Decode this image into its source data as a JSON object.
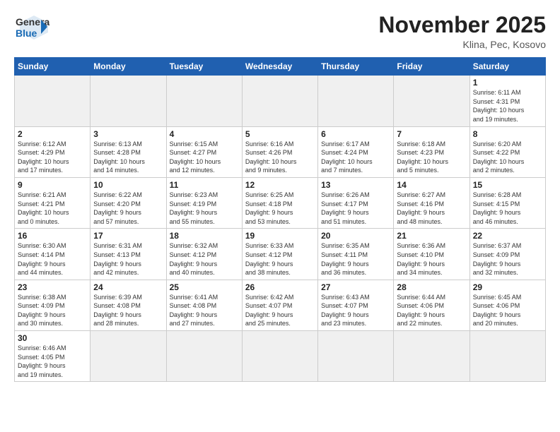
{
  "header": {
    "logo_general": "General",
    "logo_blue": "Blue",
    "month_title": "November 2025",
    "location": "Klina, Pec, Kosovo"
  },
  "days_of_week": [
    "Sunday",
    "Monday",
    "Tuesday",
    "Wednesday",
    "Thursday",
    "Friday",
    "Saturday"
  ],
  "weeks": [
    [
      {
        "day": "",
        "info": "",
        "empty": true
      },
      {
        "day": "",
        "info": "",
        "empty": true
      },
      {
        "day": "",
        "info": "",
        "empty": true
      },
      {
        "day": "",
        "info": "",
        "empty": true
      },
      {
        "day": "",
        "info": "",
        "empty": true
      },
      {
        "day": "",
        "info": "",
        "empty": true
      },
      {
        "day": "1",
        "info": "Sunrise: 6:11 AM\nSunset: 4:31 PM\nDaylight: 10 hours\nand 19 minutes."
      }
    ],
    [
      {
        "day": "2",
        "info": "Sunrise: 6:12 AM\nSunset: 4:29 PM\nDaylight: 10 hours\nand 17 minutes."
      },
      {
        "day": "3",
        "info": "Sunrise: 6:13 AM\nSunset: 4:28 PM\nDaylight: 10 hours\nand 14 minutes."
      },
      {
        "day": "4",
        "info": "Sunrise: 6:15 AM\nSunset: 4:27 PM\nDaylight: 10 hours\nand 12 minutes."
      },
      {
        "day": "5",
        "info": "Sunrise: 6:16 AM\nSunset: 4:26 PM\nDaylight: 10 hours\nand 9 minutes."
      },
      {
        "day": "6",
        "info": "Sunrise: 6:17 AM\nSunset: 4:24 PM\nDaylight: 10 hours\nand 7 minutes."
      },
      {
        "day": "7",
        "info": "Sunrise: 6:18 AM\nSunset: 4:23 PM\nDaylight: 10 hours\nand 5 minutes."
      },
      {
        "day": "8",
        "info": "Sunrise: 6:20 AM\nSunset: 4:22 PM\nDaylight: 10 hours\nand 2 minutes."
      }
    ],
    [
      {
        "day": "9",
        "info": "Sunrise: 6:21 AM\nSunset: 4:21 PM\nDaylight: 10 hours\nand 0 minutes."
      },
      {
        "day": "10",
        "info": "Sunrise: 6:22 AM\nSunset: 4:20 PM\nDaylight: 9 hours\nand 57 minutes."
      },
      {
        "day": "11",
        "info": "Sunrise: 6:23 AM\nSunset: 4:19 PM\nDaylight: 9 hours\nand 55 minutes."
      },
      {
        "day": "12",
        "info": "Sunrise: 6:25 AM\nSunset: 4:18 PM\nDaylight: 9 hours\nand 53 minutes."
      },
      {
        "day": "13",
        "info": "Sunrise: 6:26 AM\nSunset: 4:17 PM\nDaylight: 9 hours\nand 51 minutes."
      },
      {
        "day": "14",
        "info": "Sunrise: 6:27 AM\nSunset: 4:16 PM\nDaylight: 9 hours\nand 48 minutes."
      },
      {
        "day": "15",
        "info": "Sunrise: 6:28 AM\nSunset: 4:15 PM\nDaylight: 9 hours\nand 46 minutes."
      }
    ],
    [
      {
        "day": "16",
        "info": "Sunrise: 6:30 AM\nSunset: 4:14 PM\nDaylight: 9 hours\nand 44 minutes."
      },
      {
        "day": "17",
        "info": "Sunrise: 6:31 AM\nSunset: 4:13 PM\nDaylight: 9 hours\nand 42 minutes."
      },
      {
        "day": "18",
        "info": "Sunrise: 6:32 AM\nSunset: 4:12 PM\nDaylight: 9 hours\nand 40 minutes."
      },
      {
        "day": "19",
        "info": "Sunrise: 6:33 AM\nSunset: 4:12 PM\nDaylight: 9 hours\nand 38 minutes."
      },
      {
        "day": "20",
        "info": "Sunrise: 6:35 AM\nSunset: 4:11 PM\nDaylight: 9 hours\nand 36 minutes."
      },
      {
        "day": "21",
        "info": "Sunrise: 6:36 AM\nSunset: 4:10 PM\nDaylight: 9 hours\nand 34 minutes."
      },
      {
        "day": "22",
        "info": "Sunrise: 6:37 AM\nSunset: 4:09 PM\nDaylight: 9 hours\nand 32 minutes."
      }
    ],
    [
      {
        "day": "23",
        "info": "Sunrise: 6:38 AM\nSunset: 4:09 PM\nDaylight: 9 hours\nand 30 minutes."
      },
      {
        "day": "24",
        "info": "Sunrise: 6:39 AM\nSunset: 4:08 PM\nDaylight: 9 hours\nand 28 minutes."
      },
      {
        "day": "25",
        "info": "Sunrise: 6:41 AM\nSunset: 4:08 PM\nDaylight: 9 hours\nand 27 minutes."
      },
      {
        "day": "26",
        "info": "Sunrise: 6:42 AM\nSunset: 4:07 PM\nDaylight: 9 hours\nand 25 minutes."
      },
      {
        "day": "27",
        "info": "Sunrise: 6:43 AM\nSunset: 4:07 PM\nDaylight: 9 hours\nand 23 minutes."
      },
      {
        "day": "28",
        "info": "Sunrise: 6:44 AM\nSunset: 4:06 PM\nDaylight: 9 hours\nand 22 minutes."
      },
      {
        "day": "29",
        "info": "Sunrise: 6:45 AM\nSunset: 4:06 PM\nDaylight: 9 hours\nand 20 minutes."
      }
    ],
    [
      {
        "day": "30",
        "info": "Sunrise: 6:46 AM\nSunset: 4:05 PM\nDaylight: 9 hours\nand 19 minutes."
      },
      {
        "day": "",
        "info": "",
        "empty": true
      },
      {
        "day": "",
        "info": "",
        "empty": true
      },
      {
        "day": "",
        "info": "",
        "empty": true
      },
      {
        "day": "",
        "info": "",
        "empty": true
      },
      {
        "day": "",
        "info": "",
        "empty": true
      },
      {
        "day": "",
        "info": "",
        "empty": true
      }
    ]
  ]
}
